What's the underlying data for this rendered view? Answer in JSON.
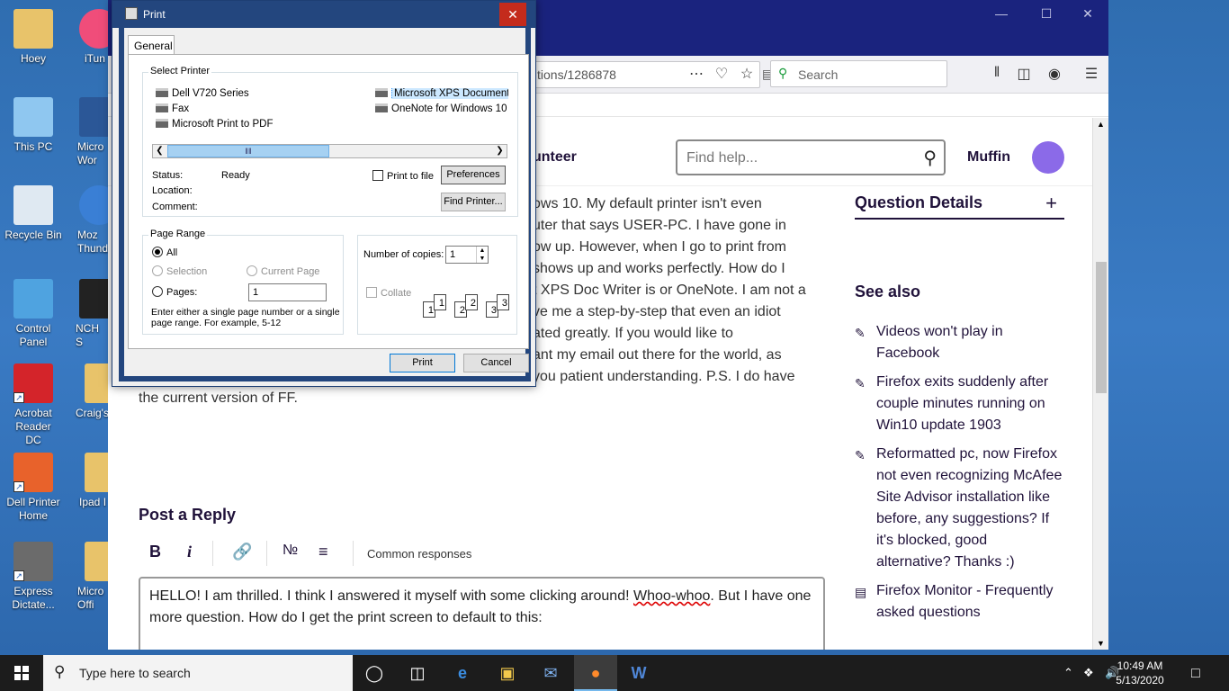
{
  "desktop": {
    "icons": [
      {
        "label": "Hoey"
      },
      {
        "label": "This PC"
      },
      {
        "label": "Recycle Bin"
      },
      {
        "label": "Control Panel"
      },
      {
        "label": "Acrobat Reader DC"
      },
      {
        "label": "Dell Printer Home"
      },
      {
        "label": "Express Dictate..."
      },
      {
        "label": "iTun"
      },
      {
        "label": "Micro Wor"
      },
      {
        "label": "Moz Thunde"
      },
      {
        "label": "NCH S"
      },
      {
        "label": "Craig's"
      },
      {
        "label": "Ipad I"
      },
      {
        "label": "Micro Offi"
      }
    ]
  },
  "browser": {
    "url": "tions/1286878",
    "search_placeholder": "Search",
    "site": {
      "volunteer_label": "unteer",
      "find_help_placeholder": "Find help...",
      "username": "Muffin"
    },
    "question_lines": [
      "ows 10. My default printer isn't even",
      "uter that says USER-PC. I have gone in",
      "ow up. However, when I go to print from",
      "shows up and works perfectly. How do I",
      "t XPS Doc Writer is or OneNote. I am not a",
      "ve me a step-by-step that even an idiot",
      "ated greatly. If you would like to",
      "ant my email out there for the world, as",
      "you patient understanding. P.S. I do have",
      "the current version of FF."
    ],
    "sidebar": {
      "details_heading": "Question Details",
      "see_also_heading": "See also",
      "see_also": [
        {
          "text": "Videos won't play in Facebook",
          "icon": "edit-icon"
        },
        {
          "text": "Firefox exits suddenly after couple minutes running on Win10 update 1903",
          "icon": "edit-icon"
        },
        {
          "text": "Reformatted pc, now Firefox not even recognizing McAfee Site Advisor installation like before, any suggestions? If it's blocked, good alternative? Thanks :)",
          "icon": "edit-icon"
        },
        {
          "text": "Firefox Monitor - Frequently asked questions",
          "icon": "document-icon"
        }
      ]
    },
    "reply": {
      "heading": "Post a Reply",
      "common_responses": "Common responses",
      "text_before": "HELLO!  I am thrilled.  I think I answered it myself with some clicking around!  ",
      "misspelled": "Whoo-whoo",
      "text_after": ".  But I have one more question.  How do I get the print screen to default to this:"
    }
  },
  "print_dialog": {
    "title": "Print",
    "tab_general": "General",
    "select_printer": "Select Printer",
    "printers": [
      {
        "name": "Dell V720 Series",
        "default": true
      },
      {
        "name": "Fax"
      },
      {
        "name": "Microsoft Print to PDF"
      },
      {
        "name": "Microsoft XPS Document Writer",
        "selected": true
      },
      {
        "name": "OneNote for Windows 10"
      }
    ],
    "status_label": "Status:",
    "status_value": "Ready",
    "location_label": "Location:",
    "comment_label": "Comment:",
    "print_to_file": "Print to file",
    "preferences": "Preferences",
    "find_printer": "Find Printer...",
    "page_range": "Page Range",
    "all": "All",
    "selection": "Selection",
    "current_page": "Current Page",
    "pages": "Pages:",
    "pages_value": "1",
    "hint": "Enter either a single page number or a single page range.  For example, 5-12",
    "copies_label": "Number of copies:",
    "copies_value": "1",
    "collate": "Collate",
    "print_btn": "Print",
    "cancel_btn": "Cancel"
  },
  "taskbar": {
    "search_placeholder": "Type here to search",
    "time": "10:49 AM",
    "date": "5/13/2020"
  }
}
